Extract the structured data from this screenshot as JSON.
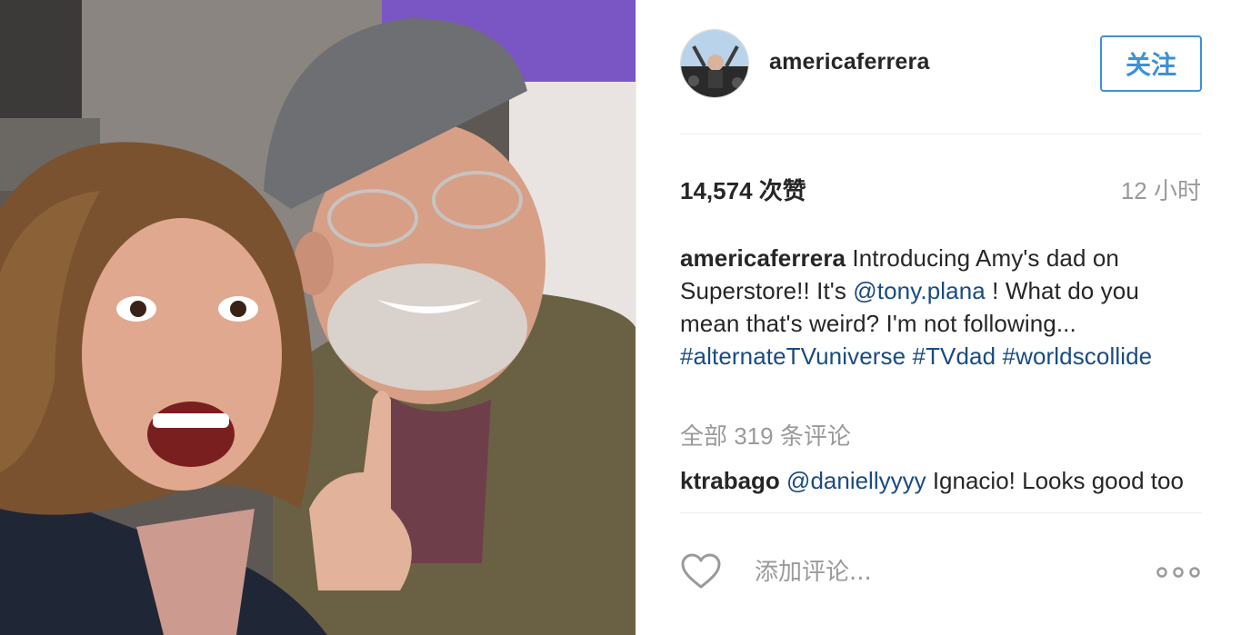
{
  "post": {
    "username": "americaferrera",
    "follow_label": "关注",
    "likes_text": "14,574 次赞",
    "time_text": "12 小时",
    "caption": {
      "author": "americaferrera",
      "text_1": " Introducing Amy's dad on Superstore!! It's ",
      "mention": "@tony.plana",
      "text_2": " ! What do you mean that's weird? I'm not following... ",
      "hashtag_1": "#alternateTVuniverse",
      "hashtag_2": "#TVdad",
      "hashtag_3": "#worldscollide"
    },
    "all_comments_text": "全部 319 条评论",
    "comments": [
      {
        "user": "ktrabago",
        "mention": "@daniellyyyy",
        "text": " Ignacio! Looks good too"
      }
    ],
    "comment_placeholder": "添加评论...",
    "icons": {
      "like": "heart-outline-icon",
      "more": "more-dots-icon"
    }
  },
  "colors": {
    "link": "#1a4b82",
    "follow": "#3f90d6",
    "muted": "#9a9a9a",
    "text": "#262626"
  }
}
